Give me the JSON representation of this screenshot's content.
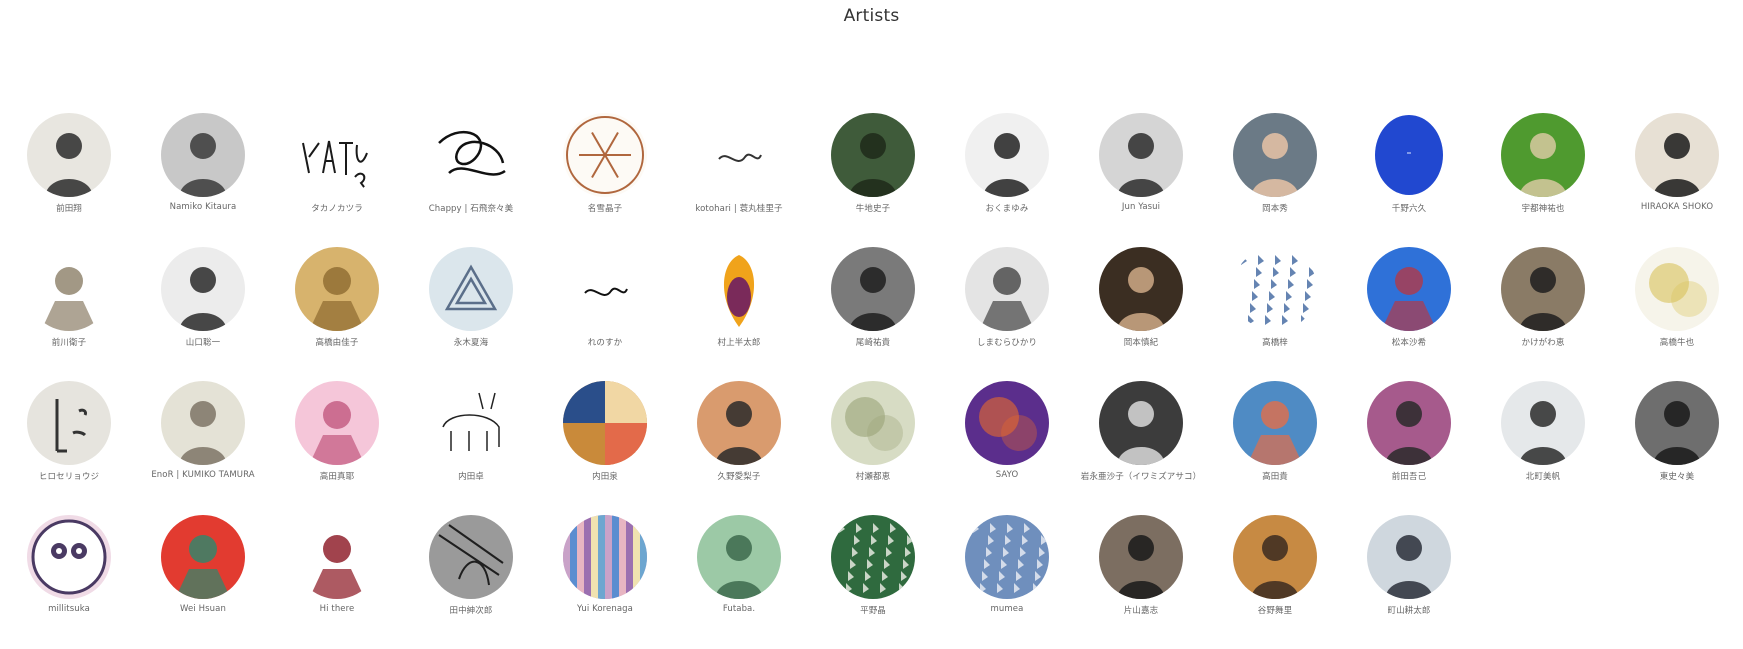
{
  "page": {
    "title": "Artists"
  },
  "artists": [
    {
      "name": "前田翔",
      "icon": "person-photo-icon",
      "bg": "#e8e6e0",
      "fg": "#2a2a2a"
    },
    {
      "name": "Namiko Kitaura",
      "icon": "person-photo-icon",
      "bg": "#c8c8c8",
      "fg": "#3a3a3a"
    },
    {
      "name": "タカノカツラ",
      "icon": "handwriting-logo-icon",
      "bg": "#ffffff",
      "fg": "#1a1a1a"
    },
    {
      "name": "Chappy | 石飛奈々美",
      "icon": "line-drawing-icon",
      "bg": "#ffffff",
      "fg": "#111111"
    },
    {
      "name": "名雪晶子",
      "icon": "snowflake-emblem-icon",
      "bg": "#fdfaf5",
      "fg": "#b0673e"
    },
    {
      "name": "kotohari | 蓑丸桂里子",
      "icon": "text-logo-icon",
      "bg": "#ffffff",
      "fg": "#333333"
    },
    {
      "name": "牛地史子",
      "icon": "person-photo-icon",
      "bg": "#3f5b3a",
      "fg": "#1e2a1a"
    },
    {
      "name": "おくまゆみ",
      "icon": "person-photo-icon",
      "bg": "#f0f0f0",
      "fg": "#222222"
    },
    {
      "name": "Jun Yasui",
      "icon": "person-photo-icon",
      "bg": "#d5d5d5",
      "fg": "#2b2b2b"
    },
    {
      "name": "岡本秀",
      "icon": "person-photo-icon",
      "bg": "#6b7a86",
      "fg": "#e8c3a6"
    },
    {
      "name": "千野六久",
      "icon": "blue-shape-icon",
      "bg": "#ffffff",
      "fg": "#2148d0"
    },
    {
      "name": "宇都神祐也",
      "icon": "person-photo-icon",
      "bg": "#4f9a2f",
      "fg": "#d7c9a0"
    },
    {
      "name": "HIRAOKA SHOKO",
      "icon": "person-photo-icon",
      "bg": "#e7e0d4",
      "fg": "#1a1a1a"
    },
    {
      "name": "前川衛子",
      "icon": "illustration-icon",
      "bg": "#ffffff",
      "fg": "#8b7e66"
    },
    {
      "name": "山口聡一",
      "icon": "person-photo-icon",
      "bg": "#ececec",
      "fg": "#2a2a2a"
    },
    {
      "name": "高橋由佳子",
      "icon": "illustration-icon",
      "bg": "#d7b36d",
      "fg": "#8d6a2f"
    },
    {
      "name": "永木夏海",
      "icon": "geometric-logo-icon",
      "bg": "#dbe6ec",
      "fg": "#5b6f8a"
    },
    {
      "name": "れのすか",
      "icon": "text-logo-icon",
      "bg": "#ffffff",
      "fg": "#111111"
    },
    {
      "name": "村上半太郎",
      "icon": "papaya-icon",
      "bg": "#ffffff",
      "fg": "#f0a31b"
    },
    {
      "name": "尾崎祐貴",
      "icon": "person-photo-icon",
      "bg": "#7a7a7a",
      "fg": "#1f1f1f"
    },
    {
      "name": "しまむらひかり",
      "icon": "illustration-icon",
      "bg": "#e4e4e4",
      "fg": "#444444"
    },
    {
      "name": "岡本慎紀",
      "icon": "person-photo-icon",
      "bg": "#3b2e22",
      "fg": "#cfa986"
    },
    {
      "name": "高橋梓",
      "icon": "pattern-icon",
      "bg": "#ffffff",
      "fg": "#4a6ea5"
    },
    {
      "name": "松本沙希",
      "icon": "illustration-icon",
      "bg": "#2f71d8",
      "fg": "#b23a48"
    },
    {
      "name": "かけがわ恵",
      "icon": "person-photo-icon",
      "bg": "#8a7b66",
      "fg": "#1e1e1e"
    },
    {
      "name": "高橋牛也",
      "icon": "abstract-art-icon",
      "bg": "#f6f4ea",
      "fg": "#d9c25a"
    },
    {
      "name": "ヒロセリョウジ",
      "icon": "face-drawing-icon",
      "bg": "#e6e4de",
      "fg": "#333333"
    },
    {
      "name": "EnoR | KUMIKO TAMURA",
      "icon": "person-photo-icon",
      "bg": "#e4e2d6",
      "fg": "#7e7466"
    },
    {
      "name": "高田真耶",
      "icon": "illustration-icon",
      "bg": "#f5c6d9",
      "fg": "#c2577e"
    },
    {
      "name": "内田卓",
      "icon": "animal-drawing-icon",
      "bg": "#ffffff",
      "fg": "#222222"
    },
    {
      "name": "内田泉",
      "icon": "collage-icon",
      "bg": "#c98a3a",
      "fg": "#2a4e8a"
    },
    {
      "name": "久野愛梨子",
      "icon": "person-photo-icon",
      "bg": "#d99b6e",
      "fg": "#2a2a2a"
    },
    {
      "name": "村瀬都恵",
      "icon": "abstract-art-icon",
      "bg": "#d7dcc4",
      "fg": "#9aa478"
    },
    {
      "name": "SAYO",
      "icon": "abstract-art-icon",
      "bg": "#5b2e8c",
      "fg": "#e86a2c"
    },
    {
      "name": "岩永亜沙子（イワミズアサコ）",
      "icon": "person-photo-icon",
      "bg": "#3c3c3c",
      "fg": "#d9d9d9"
    },
    {
      "name": "高田貴",
      "icon": "illustration-icon",
      "bg": "#4f8bc4",
      "fg": "#e26e4a"
    },
    {
      "name": "前田吾己",
      "icon": "person-photo-icon",
      "bg": "#a65a8c",
      "fg": "#2a2a2a"
    },
    {
      "name": "北町美帆",
      "icon": "person-photo-icon",
      "bg": "#e5e8ea",
      "fg": "#2b2b2b"
    },
    {
      "name": "東史々美",
      "icon": "person-photo-icon",
      "bg": "#6e6e6e",
      "fg": "#1a1a1a"
    },
    {
      "name": "millitsuka",
      "icon": "lemur-illustration-icon",
      "bg": "#f0dbe6",
      "fg": "#4a3a63"
    },
    {
      "name": "Wei Hsuan",
      "icon": "illustration-icon",
      "bg": "#e23b30",
      "fg": "#2b8a6e"
    },
    {
      "name": "Hi there",
      "icon": "illustration-icon",
      "bg": "#ffffff",
      "fg": "#8a1420"
    },
    {
      "name": "田中紳次郎",
      "icon": "sketch-icon",
      "bg": "#9a9a9a",
      "fg": "#1f1f1f"
    },
    {
      "name": "Yui Korenaga",
      "icon": "stripe-art-icon",
      "bg": "#c9a2c8",
      "fg": "#5a8dd0"
    },
    {
      "name": "Futaba.",
      "icon": "person-photo-icon",
      "bg": "#9cc9a6",
      "fg": "#3d6a4c"
    },
    {
      "name": "平野晶",
      "icon": "pattern-icon",
      "bg": "#2f6a3e",
      "fg": "#e5e9df"
    },
    {
      "name": "mumea",
      "icon": "pattern-icon",
      "bg": "#6f8fbd",
      "fg": "#e6eaf2"
    },
    {
      "name": "片山嘉志",
      "icon": "person-photo-icon",
      "bg": "#7c6e61",
      "fg": "#1a1a1a"
    },
    {
      "name": "谷野舞里",
      "icon": "person-photo-icon",
      "bg": "#c78a43",
      "fg": "#3b2a20"
    },
    {
      "name": "町山耕太郎",
      "icon": "person-photo-icon",
      "bg": "#cfd7de",
      "fg": "#2a2f3a"
    }
  ]
}
